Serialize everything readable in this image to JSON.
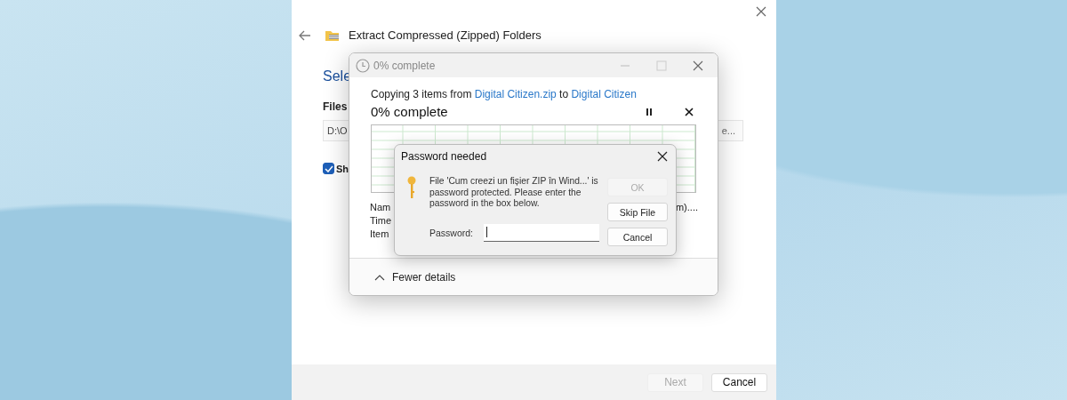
{
  "wizard": {
    "title": "Extract Compressed (Zipped) Folders",
    "heading": "Sele",
    "files_label": "Files",
    "path_field": {
      "value": "D:\\O"
    },
    "browse_button": "e...",
    "checkbox": {
      "label": "Sh",
      "checked": true
    },
    "buttons": [
      {
        "label": "Next",
        "disabled": true
      },
      {
        "label": "Cancel",
        "disabled": false
      }
    ]
  },
  "progress_window": {
    "title": "0% complete",
    "status_parts": [
      {
        "kind": "text",
        "text": "Copying 3 items from "
      },
      {
        "kind": "link",
        "text": "Digital Citizen.zip"
      },
      {
        "kind": "text",
        "text": " to "
      },
      {
        "kind": "link",
        "text": "Digital Citizen"
      }
    ],
    "percent": "0% complete",
    "details": [
      "Nam",
      "Time",
      "Item"
    ],
    "details_right": "m)....",
    "toggle": "Fewer details"
  },
  "password_dialog": {
    "title": "Password needed",
    "message": "File 'Cum creezi un fișier ZIP în Wind...' is password protected.  Please enter the password in the box below.",
    "password_label": "Password:",
    "password_field": {
      "focused": true
    },
    "buttons": [
      {
        "label": "OK",
        "disabled": true
      },
      {
        "label": "Skip File",
        "disabled": false
      },
      {
        "label": "Cancel",
        "disabled": false
      }
    ]
  }
}
